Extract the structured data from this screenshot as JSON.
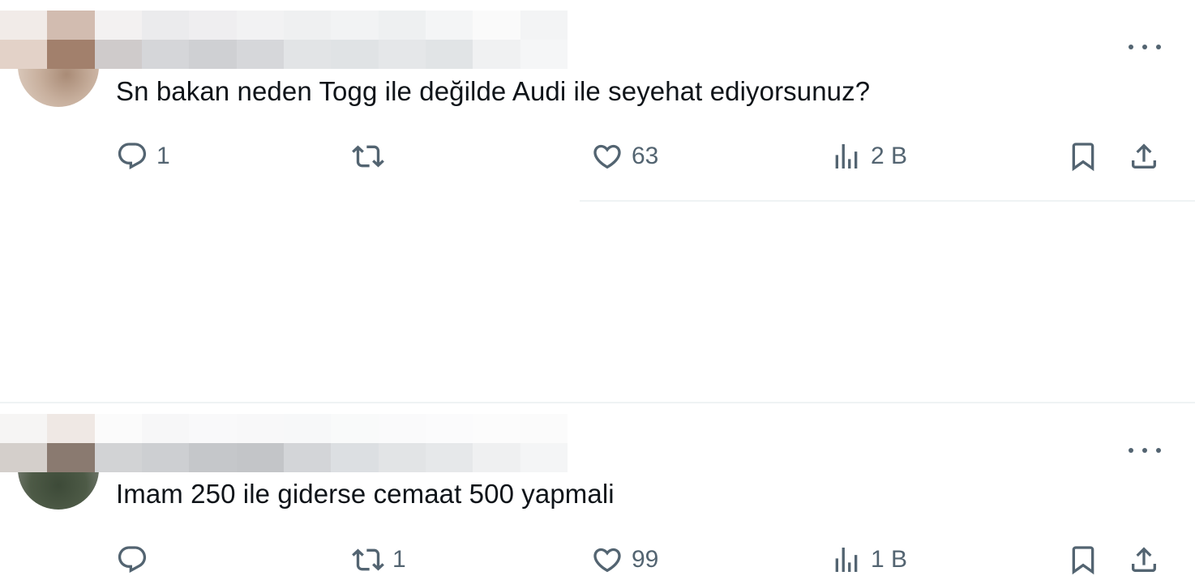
{
  "tweets": [
    {
      "text": "Sn bakan neden Togg ile değilde Audi ile seyehat ediyorsunuz?",
      "replies": "1",
      "retweets": "",
      "likes": "63",
      "views": "2 B"
    },
    {
      "text": "Imam 250 ile giderse cemaat 500 yapmali",
      "replies": "",
      "retweets": "1",
      "likes": "99",
      "views": "1 B"
    }
  ],
  "icons": {
    "more": "more-options-icon",
    "reply": "reply-icon",
    "retweet": "retweet-icon",
    "like": "heart-icon",
    "views": "views-chart-icon",
    "bookmark": "bookmark-icon",
    "share": "share-icon"
  },
  "colors": {
    "text": "#0f1419",
    "secondary": "#536471",
    "divider": "#eff3f4"
  }
}
